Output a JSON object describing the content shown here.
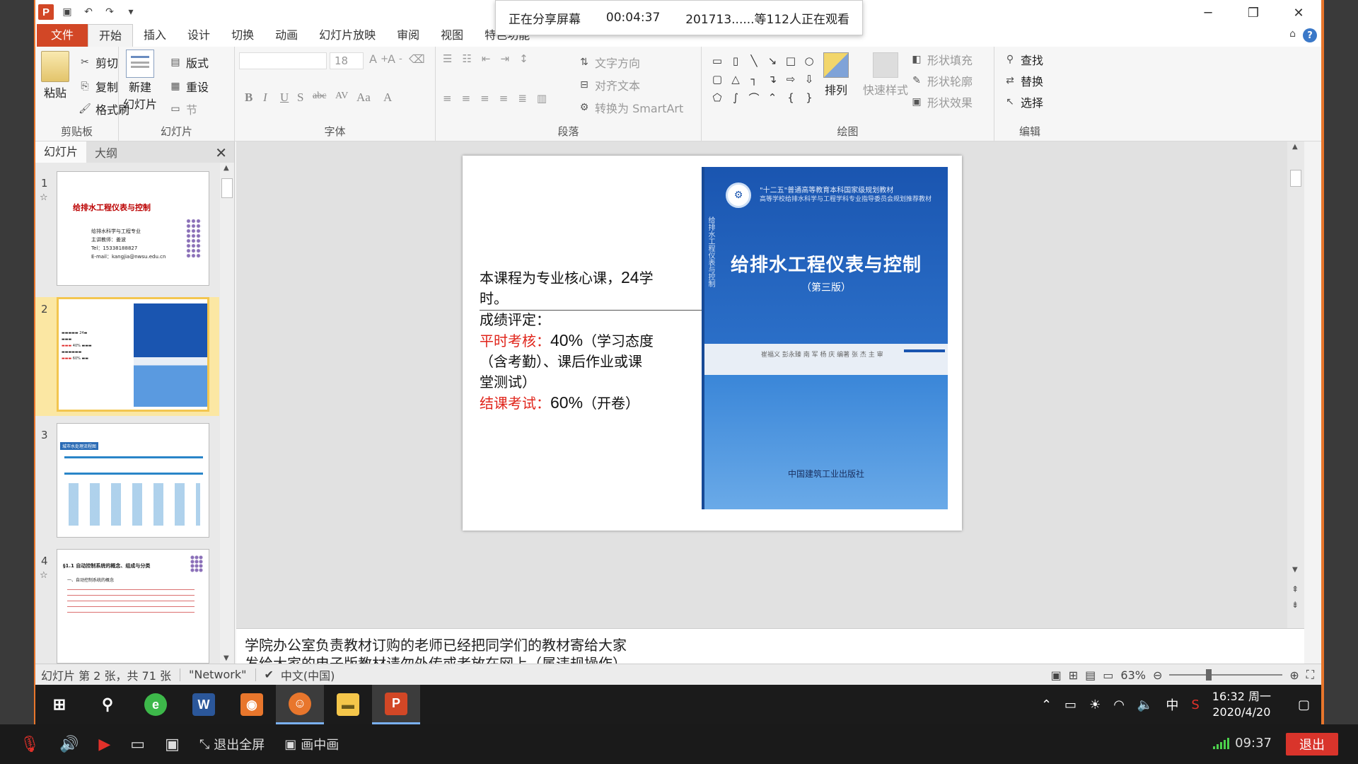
{
  "share_bar": {
    "status": "正在分享屏幕",
    "elapsed": "00:04:37",
    "viewers": "201713......等112人正在观看"
  },
  "tabs": [
    "文件",
    "开始",
    "插入",
    "设计",
    "切换",
    "动画",
    "幻灯片放映",
    "审阅",
    "视图",
    "特色功能"
  ],
  "active_tab": "开始",
  "ribbon": {
    "clipboard": {
      "paste": "粘贴",
      "cut": "剪切",
      "copy": "复制",
      "format_painter": "格式刷",
      "label": "剪贴板"
    },
    "slides": {
      "new_slide_1": "新建",
      "new_slide_2": "幻灯片",
      "layout": "版式",
      "reset": "重设",
      "section": "节",
      "label": "幻灯片"
    },
    "font": {
      "font_size": "18",
      "label": "字体",
      "bold": "B",
      "italic": "I",
      "underline": "U",
      "shadow": "S",
      "strike": "abc",
      "spacing": "AV",
      "case": "Aa",
      "color": "A"
    },
    "paragraph": {
      "text_direction": "文字方向",
      "align_text": "对齐文本",
      "smartart": "转换为 SmartArt",
      "label": "段落"
    },
    "drawing": {
      "arrange": "排列",
      "quick_styles": "快速样式",
      "shape_fill": "形状填充",
      "shape_outline": "形状轮廓",
      "shape_effects": "形状效果",
      "label": "绘图"
    },
    "editing": {
      "find": "查找",
      "replace": "替换",
      "select": "选择",
      "label": "编辑"
    }
  },
  "left_pane": {
    "tab_slides": "幻灯片",
    "tab_outline": "大纲",
    "thumbs": [
      {
        "num": "1",
        "title": "给排水工程仪表与控制",
        "lines": [
          "给排水科学与工程专业",
          "主讲教师：姜波",
          "Tel：15338188827",
          "E-mail：kangjia@nwsu.edu.cn"
        ]
      },
      {
        "num": "2"
      },
      {
        "num": "3",
        "title": "城市水处理流程图"
      },
      {
        "num": "4",
        "title": "§1.1 自动控制系统的概念、组成与分类",
        "lines": [
          "一、自动控制系统的概念"
        ]
      }
    ]
  },
  "slide": {
    "line1a": "本课程为专业核心课，",
    "line1b": "24",
    "line1c": "学",
    "line2": "时。",
    "grading_title": "成绩评定：",
    "usual_label": "平时考核：",
    "usual_pct": "40%",
    "usual_desc_1": "（学习态度",
    "usual_desc_2": "（含考勤）、课后作业或课",
    "usual_desc_3": "堂测试）",
    "final_label": "结课考试：",
    "final_pct": "60%",
    "final_desc": "（开卷）",
    "book": {
      "series_1": "\"十二五\"普通高等教育本科国家级规划教材",
      "series_2": "高等学校给排水科学与工程学科专业指导委员会规划推荐教材",
      "title": "给排水工程仪表与控制",
      "edition": "（第三版）",
      "spine": "给排水工程仪表与控制",
      "authors": "崔福义  彭永臻  南  军  杨  庆  编著    张  杰  主  审",
      "publisher": "中国建筑工业出版社"
    }
  },
  "notes": {
    "line1": "学院办公室负责教材订购的老师已经把同学们的教材寄给大家",
    "line2": "发给大家的电子版教材请勿外传或者放在网上（属违规操作）"
  },
  "status": {
    "slide_info": "幻灯片 第 2 张，共 71 张",
    "theme": "\"Network\"",
    "language": "中文(中国)",
    "zoom": "63%"
  },
  "taskbar": {
    "clock_time": "16:32 周一",
    "clock_date": "2020/4/20",
    "ime": "中"
  },
  "meetbar": {
    "exit_fullscreen": "退出全屏",
    "pip": "画中画",
    "time": "09:37",
    "exit": "退出"
  }
}
